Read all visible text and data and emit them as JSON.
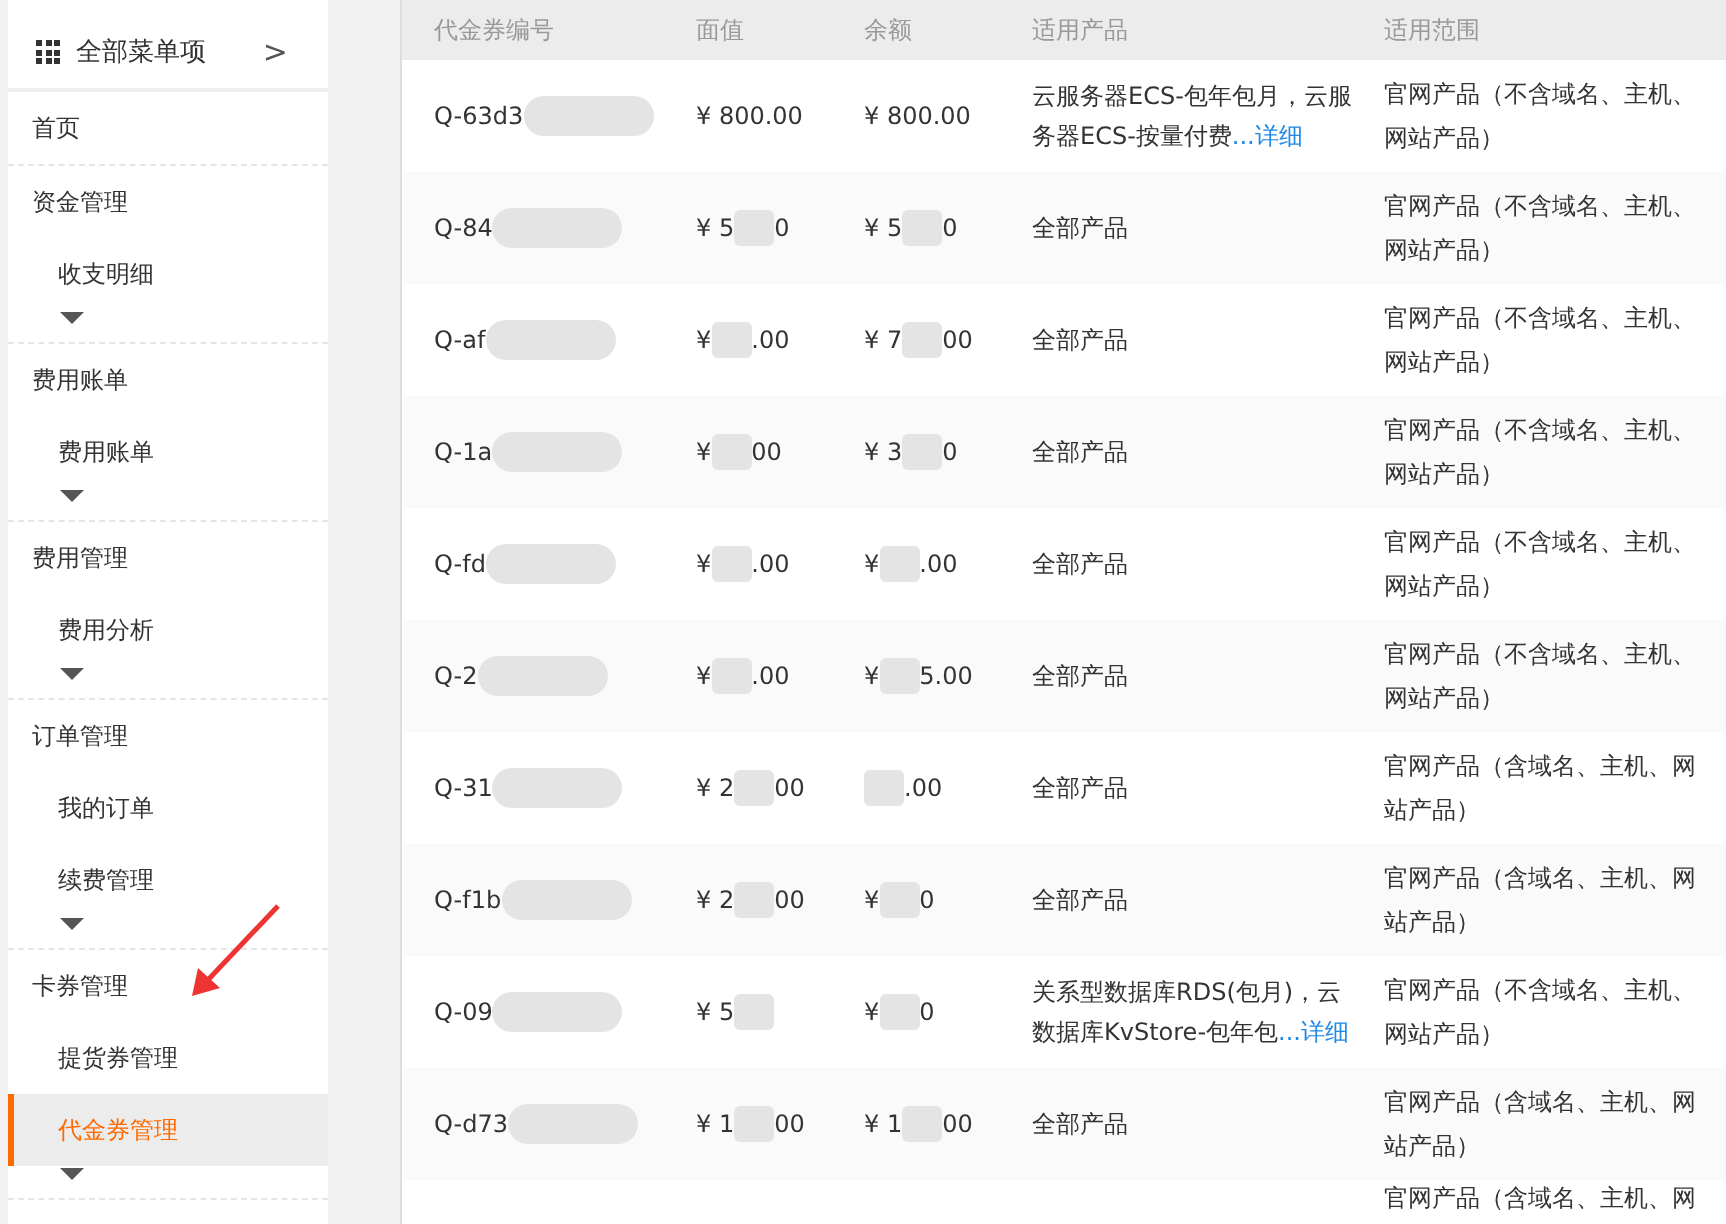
{
  "sidebar": {
    "header": {
      "title": "全部菜单项",
      "chevron": ">"
    },
    "groups": [
      {
        "title": "首页",
        "expandable": false
      },
      {
        "title": "资金管理",
        "items": [
          {
            "label": "收支明细",
            "selected": false
          }
        ],
        "expandable": true
      },
      {
        "title": "费用账单",
        "items": [
          {
            "label": "费用账单",
            "selected": false
          }
        ],
        "expandable": true
      },
      {
        "title": "费用管理",
        "items": [
          {
            "label": "费用分析",
            "selected": false
          }
        ],
        "expandable": true
      },
      {
        "title": "订单管理",
        "items": [
          {
            "label": "我的订单",
            "selected": false
          },
          {
            "label": "续费管理",
            "selected": false
          }
        ],
        "expandable": true
      },
      {
        "title": "卡券管理",
        "items": [
          {
            "label": "提货券管理",
            "selected": false
          },
          {
            "label": "代金券管理",
            "selected": true
          }
        ],
        "expandable": true
      }
    ]
  },
  "table": {
    "columns": [
      "代金券编号",
      "面值",
      "余额",
      "适用产品",
      "适用范围"
    ],
    "rows": [
      {
        "id": "Q-63d3",
        "face": {
          "before": "¥ 800.00"
        },
        "balance": {
          "before": "¥ 800.00"
        },
        "product": "云服务器ECS-包年包月，云服务器ECS-按量付费",
        "detail_link": "...详细",
        "scope": "官网产品（不含域名、主机、网站产品）"
      },
      {
        "id": "Q-84",
        "face": {
          "before": "¥ 5",
          "after": "0"
        },
        "balance": {
          "before": "¥ 5",
          "after": "0"
        },
        "product": "全部产品",
        "scope": "官网产品（不含域名、主机、网站产品）"
      },
      {
        "id": "Q-af",
        "face": {
          "before": "¥",
          "after": ".00"
        },
        "balance": {
          "before": "¥ 7",
          "after": "00"
        },
        "product": "全部产品",
        "scope": "官网产品（不含域名、主机、网站产品）"
      },
      {
        "id": "Q-1a",
        "face": {
          "before": "¥",
          "after": "00"
        },
        "balance": {
          "before": "¥ 3",
          "after": "0"
        },
        "product": "全部产品",
        "scope": "官网产品（不含域名、主机、网站产品）"
      },
      {
        "id": "Q-fd",
        "face": {
          "before": "¥",
          "after": ".00"
        },
        "balance": {
          "before": "¥",
          "after": ".00"
        },
        "product": "全部产品",
        "scope": "官网产品（不含域名、主机、网站产品）"
      },
      {
        "id": "Q-2",
        "face": {
          "before": "¥",
          "after": ".00"
        },
        "balance": {
          "before": "¥",
          "after": "5.00"
        },
        "product": "全部产品",
        "scope": "官网产品（不含域名、主机、网站产品）"
      },
      {
        "id": "Q-31",
        "face": {
          "before": "¥ 2",
          "after": "00"
        },
        "balance": {
          "after": ".00"
        },
        "product": "全部产品",
        "scope": "官网产品（含域名、主机、网站产品）"
      },
      {
        "id": "Q-f1b",
        "face": {
          "before": "¥ 2",
          "after": "00"
        },
        "balance": {
          "before": "¥",
          "after": "0"
        },
        "product": "全部产品",
        "scope": "官网产品（含域名、主机、网站产品）"
      },
      {
        "id": "Q-09",
        "face": {
          "before": "¥ 5"
        },
        "balance": {
          "before": "¥",
          "after": "0"
        },
        "product": "关系型数据库RDS(包月)，云数据库KvStore-包年包",
        "detail_link": "...详细",
        "scope": "官网产品（不含域名、主机、网站产品）"
      },
      {
        "id": "Q-d73",
        "face": {
          "before": "¥ 1",
          "after": "00"
        },
        "balance": {
          "before": "¥ 1",
          "after": "00"
        },
        "product": "全部产品",
        "scope": "官网产品（含域名、主机、网站产品）"
      },
      {
        "scope": "官网产品（含域名、主机、网"
      }
    ]
  }
}
